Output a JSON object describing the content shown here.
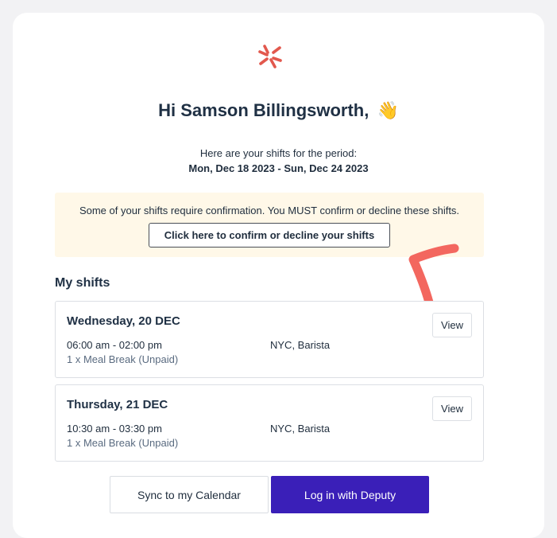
{
  "brand": {
    "logo_icon": "deputy-logo-icon",
    "logo_color": "#e2584d",
    "primary_color": "#3a1fb8",
    "notice_bg": "#fff8e8",
    "annotation_color": "#f3675f"
  },
  "greeting": {
    "text": "Hi Samson Billingsworth,",
    "emoji": "👋"
  },
  "period": {
    "intro": "Here are your shifts for the period:",
    "range": "Mon, Dec 18 2023 - Sun, Dec 24 2023"
  },
  "notice": {
    "message": "Some of your shifts require confirmation. You MUST confirm or decline these shifts.",
    "button_label": "Click here to confirm or decline your shifts"
  },
  "shifts_section": {
    "title": "My shifts",
    "items": [
      {
        "day": "Wednesday, 20 DEC",
        "time": "06:00 am - 02:00 pm",
        "break": "1 x Meal Break (Unpaid)",
        "location": "NYC, Barista",
        "view_label": "View"
      },
      {
        "day": "Thursday, 21 DEC",
        "time": "10:30 am - 03:30 pm",
        "break": "1 x Meal Break (Unpaid)",
        "location": "NYC, Barista",
        "view_label": "View"
      }
    ]
  },
  "actions": {
    "sync_label": "Sync to my Calendar",
    "login_label": "Log in with Deputy"
  }
}
